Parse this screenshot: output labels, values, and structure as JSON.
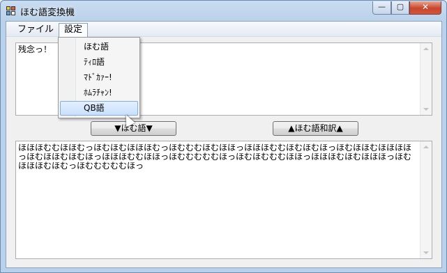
{
  "window": {
    "title": "ほむ語変換機"
  },
  "title_buttons": {
    "minimize": "—",
    "maximize": "▢",
    "close": "✕"
  },
  "menu": {
    "file": "ファイル",
    "settings": "設定"
  },
  "settings_menu": {
    "items": [
      {
        "label": "ほむ語"
      },
      {
        "label": "ﾃｨﾛ語"
      },
      {
        "label": "ﾏﾄﾞｶｧｰ!"
      },
      {
        "label": "ﾎﾑﾗﾁｬﾝ!"
      },
      {
        "label": "QB語",
        "selected": true
      }
    ]
  },
  "input_text": "残念っ！",
  "output_text": "ほほほむむほほむっほむほむほほほむっほむむむほむほほっほほほむむほむほむほっほむほほむほほほほっほむほほむほむほっほほほむむほほっほむむむむむほっほむほむむむほほっほほほむほむほほほっほむほほほむほむっほむむむむむほっ",
  "buttons": {
    "convert": "▼ほむ語▼",
    "translate_back": "▲ほむ語和訳▲"
  }
}
